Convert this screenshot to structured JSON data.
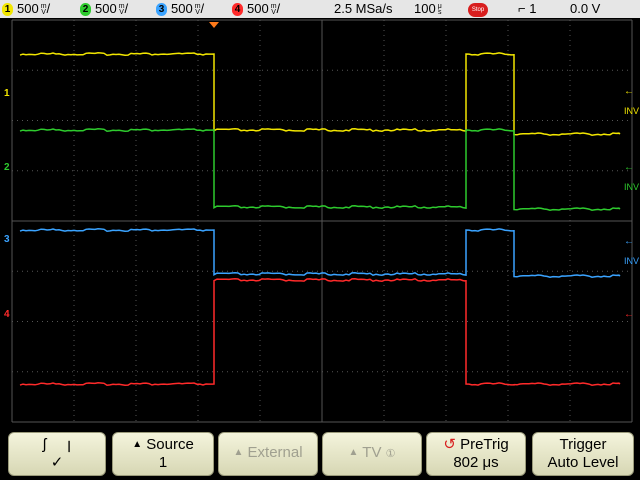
{
  "topbar": {
    "channels": [
      {
        "num": "1",
        "scale": "500",
        "unit_top": "m",
        "unit_bot": "V",
        "color": "#f2e600"
      },
      {
        "num": "2",
        "scale": "500",
        "unit_top": "m",
        "unit_bot": "V",
        "color": "#2ecb2e"
      },
      {
        "num": "3",
        "scale": "500",
        "unit_top": "m",
        "unit_bot": "V",
        "color": "#3aa3ff"
      },
      {
        "num": "4",
        "scale": "500",
        "unit_top": "m",
        "unit_bot": "V",
        "color": "#ff2a2a"
      }
    ],
    "sample_rate": "2.5 MSa/s",
    "timebase": "100",
    "timebase_unit_top": "μ",
    "timebase_unit_bot": "s",
    "run_state": "Stop",
    "trigger_edge": "ꞁ",
    "trigger_source": "1",
    "trigger_level": "0.0 V"
  },
  "scope": {
    "markers": [
      {
        "label": "1",
        "color": "#f2e600"
      },
      {
        "label": "2",
        "color": "#2ecb2e"
      },
      {
        "label": "3",
        "color": "#3aa3ff"
      },
      {
        "label": "4",
        "color": "#ff2a2a"
      }
    ],
    "inv_label": "INV"
  },
  "softkeys": {
    "slope_rise_icon": "rising-edge-icon",
    "slope_fall_icon": "falling-edge-icon",
    "slope_check": "✓",
    "source_label": "Source",
    "source_value": "1",
    "external_label": "External",
    "tv_label": "TV",
    "tv_badge": "①",
    "pretrig_label": "PreTrig",
    "pretrig_value": "802 μs",
    "trigger_label": "Trigger",
    "trigger_value": "Auto Level"
  }
}
